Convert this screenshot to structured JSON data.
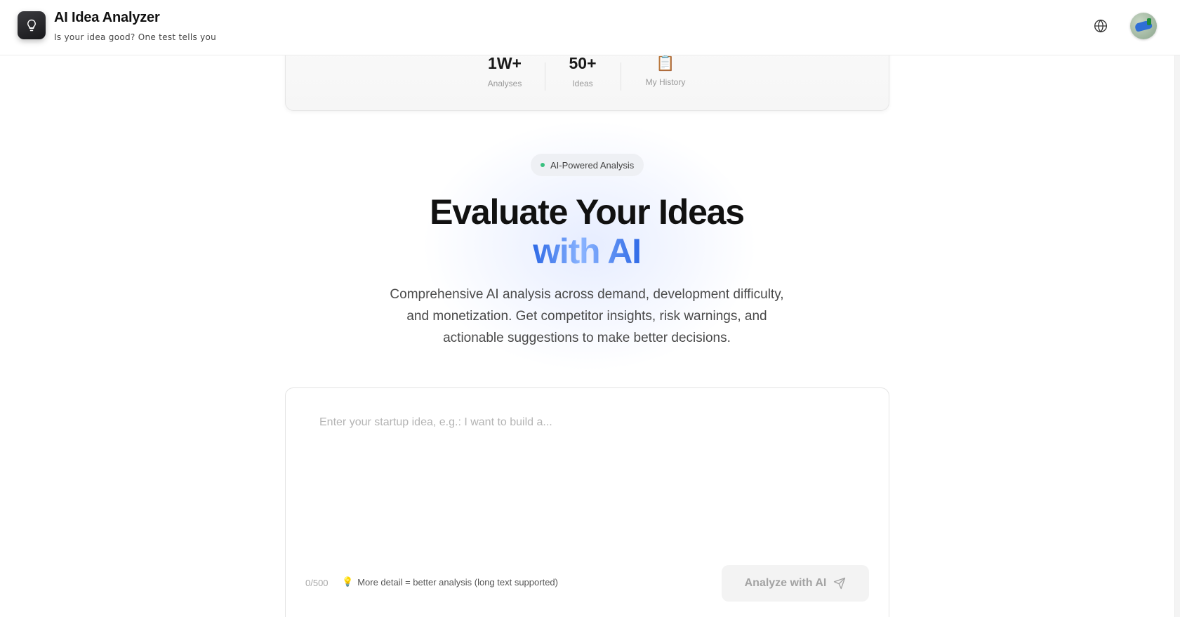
{
  "header": {
    "title": "AI Idea Analyzer",
    "subtitle": "Is your idea good? One test tells you",
    "logo_icon": "lightbulb-icon",
    "language_icon": "globe-icon"
  },
  "stats": [
    {
      "value": "1W+",
      "label": "Analyses"
    },
    {
      "value": "50+",
      "label": "Ideas"
    },
    {
      "icon": "📋",
      "label": "My History"
    }
  ],
  "hero": {
    "badge": "AI-Powered Analysis",
    "title_line1": "Evaluate Your Ideas",
    "title_line2": "with AI",
    "description": "Comprehensive AI analysis across demand, development difficulty, and monetization. Get competitor insights, risk warnings, and actionable suggestions to make better decisions."
  },
  "input": {
    "placeholder": "Enter your startup idea, e.g.: I want to build a...",
    "value": "",
    "char_count": "0/500",
    "hint_icon": "💡",
    "hint": "More detail = better analysis (long text supported)",
    "submit_label": "Analyze with AI",
    "submit_icon": "send-icon"
  },
  "colors": {
    "accent_blue": "#2f6ae6",
    "badge_dot": "#39c07f",
    "button_disabled_bg": "#f3f3f3"
  }
}
